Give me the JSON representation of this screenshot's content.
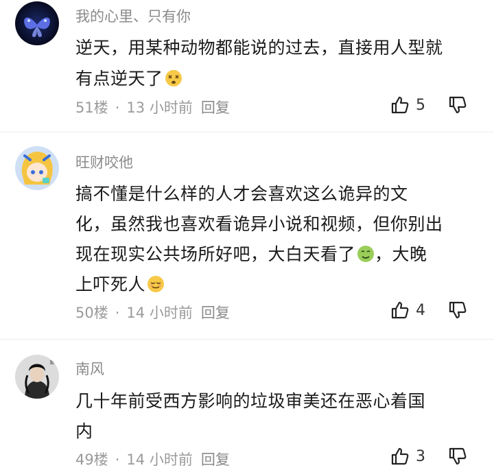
{
  "comments": [
    {
      "username": "我的心里、只有你",
      "lines": [
        "逆天，用某种动物都能说的过去，直接用人型就",
        "有点逆天了"
      ],
      "floor": "51楼",
      "time": "13 小时前",
      "reply": "回复",
      "likes": "5",
      "emoji_line1": "",
      "emoji_last": "dizzy-face-emoji"
    },
    {
      "username": "旺财咬他",
      "lines": [
        "搞不懂是什么样的人才会喜欢这么诡异的文",
        "化，虽然我也喜欢看诡异小说和视频，但你别出",
        "现在现实公共场所好吧，大白天看了",
        "，大晚",
        "上吓死人"
      ],
      "floor": "50楼",
      "time": "14 小时前",
      "reply": "回复",
      "likes": "4",
      "emoji_mid": "nauseated-face-emoji",
      "emoji_last": "relieved-face-emoji"
    },
    {
      "username": "南风",
      "lines": [
        "几十年前受西方影响的垃圾审美还在恶心着国",
        "内"
      ],
      "floor": "49楼",
      "time": "14 小时前",
      "reply": "回复",
      "likes": "3"
    }
  ],
  "separator": "·",
  "colors": {
    "text": "#1a1a1a",
    "meta": "#9a9a9a",
    "divider": "#ececec"
  }
}
